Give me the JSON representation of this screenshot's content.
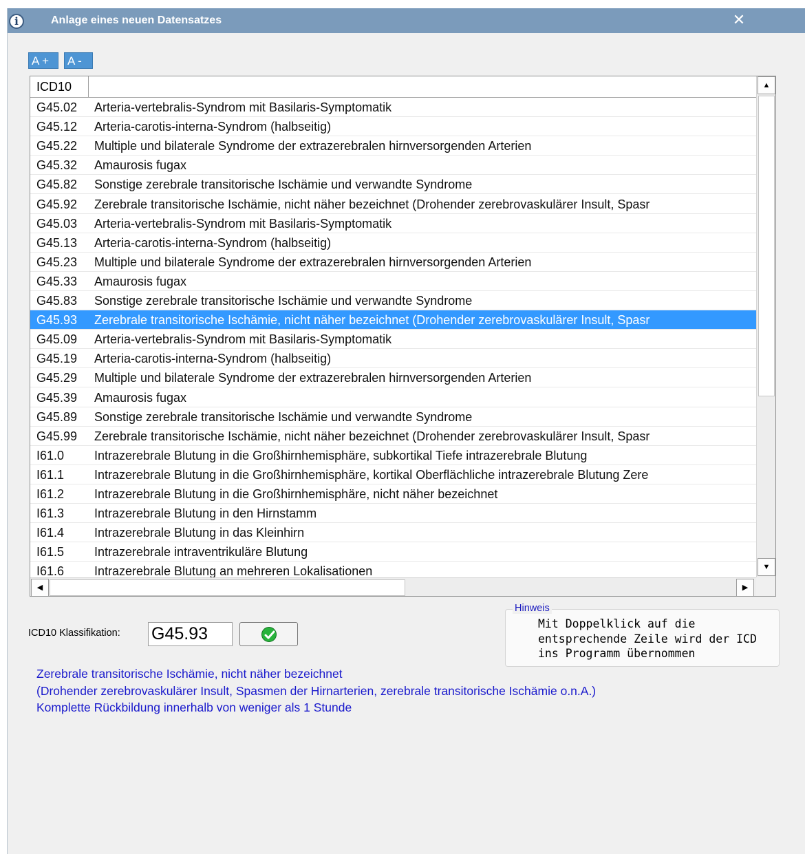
{
  "window": {
    "title": "Anlage eines neuen Datensatzes",
    "close_symbol": "✕"
  },
  "toolbar": {
    "font_increase_label": "A +",
    "font_decrease_label": "A -"
  },
  "grid": {
    "columns": [
      "ICD10",
      ""
    ],
    "selected_index": 11,
    "rows": [
      {
        "code": "G45.02",
        "desc": "Arteria-vertebralis-Syndrom mit Basilaris-Symptomatik"
      },
      {
        "code": "G45.12",
        "desc": "Arteria-carotis-interna-Syndrom (halbseitig)"
      },
      {
        "code": "G45.22",
        "desc": "Multiple und bilaterale Syndrome der extrazerebralen hirnversorgenden Arterien"
      },
      {
        "code": "G45.32",
        "desc": "Amaurosis fugax"
      },
      {
        "code": "G45.82",
        "desc": "Sonstige zerebrale transitorische Ischämie und verwandte Syndrome"
      },
      {
        "code": "G45.92",
        "desc": "Zerebrale transitorische Ischämie, nicht näher bezeichnet  (Drohender zerebrovaskulärer Insult, Spasr"
      },
      {
        "code": "G45.03",
        "desc": "Arteria-vertebralis-Syndrom mit Basilaris-Symptomatik"
      },
      {
        "code": "G45.13",
        "desc": "Arteria-carotis-interna-Syndrom (halbseitig)"
      },
      {
        "code": "G45.23",
        "desc": "Multiple und bilaterale Syndrome der extrazerebralen hirnversorgenden Arterien"
      },
      {
        "code": "G45.33",
        "desc": "Amaurosis fugax"
      },
      {
        "code": "G45.83",
        "desc": "Sonstige zerebrale transitorische Ischämie und verwandte Syndrome"
      },
      {
        "code": "G45.93",
        "desc": "Zerebrale transitorische Ischämie, nicht näher bezeichnet  (Drohender zerebrovaskulärer Insult, Spasr"
      },
      {
        "code": "G45.09",
        "desc": "Arteria-vertebralis-Syndrom mit Basilaris-Symptomatik"
      },
      {
        "code": "G45.19",
        "desc": "Arteria-carotis-interna-Syndrom (halbseitig)"
      },
      {
        "code": "G45.29",
        "desc": "Multiple und bilaterale Syndrome der extrazerebralen hirnversorgenden Arterien"
      },
      {
        "code": "G45.39",
        "desc": "Amaurosis fugax"
      },
      {
        "code": "G45.89",
        "desc": "Sonstige zerebrale transitorische Ischämie und verwandte Syndrome"
      },
      {
        "code": "G45.99",
        "desc": "Zerebrale transitorische Ischämie, nicht näher bezeichnet  (Drohender zerebrovaskulärer Insult, Spasr"
      },
      {
        "code": "I61.0",
        "desc": "Intrazerebrale Blutung in die Großhirnhemisphäre, subkortikal  Tiefe intrazerebrale Blutung"
      },
      {
        "code": "I61.1",
        "desc": "Intrazerebrale Blutung in die Großhirnhemisphäre, kortikal  Oberflächliche intrazerebrale Blutung Zere"
      },
      {
        "code": "I61.2",
        "desc": "Intrazerebrale Blutung in die Großhirnhemisphäre, nicht näher bezeichnet"
      },
      {
        "code": "I61.3",
        "desc": "Intrazerebrale Blutung in den Hirnstamm"
      },
      {
        "code": "I61.4",
        "desc": "Intrazerebrale Blutung in das Kleinhirn"
      },
      {
        "code": "I61.5",
        "desc": "Intrazerebrale intraventrikuläre Blutung"
      },
      {
        "code": "I61.6",
        "desc": "Intrazerebrale Blutung an mehreren Lokalisationen"
      }
    ],
    "scroll": {
      "up_arrow": "▲",
      "down_arrow": "▼",
      "left_arrow": "◀",
      "right_arrow": "▶"
    }
  },
  "classification": {
    "label": "ICD10 Klassifikation:",
    "value": "G45.93"
  },
  "hint": {
    "legend": "Hinweis",
    "text": "Mit Doppelklick auf die\nentsprechende Zeile wird der ICD\nins Programm übernommen"
  },
  "description": {
    "line1": "Zerebrale transitorische Ischämie, nicht näher bezeichnet",
    "line2": "(Drohender zerebrovaskulärer Insult, Spasmen der Hirnarterien, zerebrale transitorische Ischämie o.n.A.)",
    "line3": "Komplette Rückbildung innerhalb von weniger als 1 Stunde"
  },
  "colors": {
    "titlebar": "#7b9bbb",
    "selection": "#3399ff",
    "font_buttons": "#4e95d4",
    "description_text": "#1a1acc",
    "ok_icon": "#28b33c"
  },
  "icons": {
    "window": "info-icon",
    "close": "close-icon",
    "confirm": "check-icon"
  }
}
